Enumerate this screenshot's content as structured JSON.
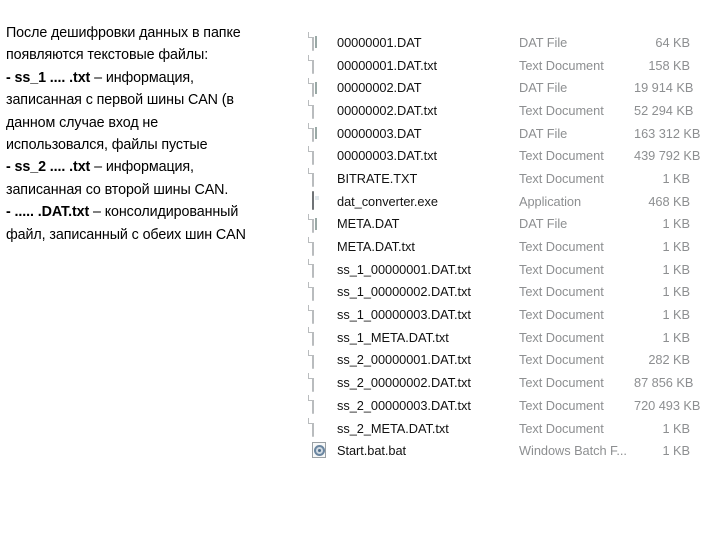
{
  "notes": {
    "lines": [
      {
        "text": "После дешифровки данных в папке",
        "bold_prefix": ""
      },
      {
        "text": "появляются текстовые файлы:",
        "bold_prefix": ""
      },
      {
        "text": " – информация,",
        "bold_prefix": "- ss_1 .... .txt"
      },
      {
        "text": "записанная с первой шины CAN (в",
        "bold_prefix": ""
      },
      {
        "text": "данном случае вход не",
        "bold_prefix": ""
      },
      {
        "text": "использовался, файлы пустые",
        "bold_prefix": ""
      },
      {
        "text": " – информация,",
        "bold_prefix": "- ss_2 .... .txt"
      },
      {
        "text": "записанная со второй шины CAN.",
        "bold_prefix": ""
      },
      {
        "text": " – консолидированный",
        "bold_prefix": "- ..... .DAT.txt"
      },
      {
        "text": "файл, записанный с обеих шин CAN",
        "bold_prefix": ""
      }
    ]
  },
  "file_list": {
    "rows": [
      {
        "icon": "dat-file-icon",
        "name": "00000001.DAT",
        "type": "DAT File",
        "size": "64 KB"
      },
      {
        "icon": "text-document-icon",
        "name": "00000001.DAT.txt",
        "type": "Text Document",
        "size": "158 KB"
      },
      {
        "icon": "dat-file-icon",
        "name": "00000002.DAT",
        "type": "DAT File",
        "size": "19 914 KB"
      },
      {
        "icon": "text-document-icon",
        "name": "00000002.DAT.txt",
        "type": "Text Document",
        "size": "52 294 KB"
      },
      {
        "icon": "dat-file-icon",
        "name": "00000003.DAT",
        "type": "DAT File",
        "size": "163 312 KB"
      },
      {
        "icon": "text-document-icon",
        "name": "00000003.DAT.txt",
        "type": "Text Document",
        "size": "439 792 KB"
      },
      {
        "icon": "text-document-icon",
        "name": "BITRATE.TXT",
        "type": "Text Document",
        "size": "1 KB"
      },
      {
        "icon": "application-exe-icon",
        "name": "dat_converter.exe",
        "type": "Application",
        "size": "468 KB"
      },
      {
        "icon": "dat-file-icon",
        "name": "META.DAT",
        "type": "DAT File",
        "size": "1 KB"
      },
      {
        "icon": "text-document-icon",
        "name": "META.DAT.txt",
        "type": "Text Document",
        "size": "1 KB"
      },
      {
        "icon": "text-document-icon",
        "name": "ss_1_00000001.DAT.txt",
        "type": "Text Document",
        "size": "1 KB"
      },
      {
        "icon": "text-document-icon",
        "name": "ss_1_00000002.DAT.txt",
        "type": "Text Document",
        "size": "1 KB"
      },
      {
        "icon": "text-document-icon",
        "name": "ss_1_00000003.DAT.txt",
        "type": "Text Document",
        "size": "1 KB"
      },
      {
        "icon": "text-document-icon",
        "name": "ss_1_META.DAT.txt",
        "type": "Text Document",
        "size": "1 KB"
      },
      {
        "icon": "text-document-icon",
        "name": "ss_2_00000001.DAT.txt",
        "type": "Text Document",
        "size": "282 KB"
      },
      {
        "icon": "text-document-icon",
        "name": "ss_2_00000002.DAT.txt",
        "type": "Text Document",
        "size": "87 856 KB"
      },
      {
        "icon": "text-document-icon",
        "name": "ss_2_00000003.DAT.txt",
        "type": "Text Document",
        "size": "720 493 KB"
      },
      {
        "icon": "text-document-icon",
        "name": "ss_2_META.DAT.txt",
        "type": "Text Document",
        "size": "1 KB"
      },
      {
        "icon": "batch-file-icon",
        "name": "Start.bat.bat",
        "type": "Windows Batch F...",
        "size": "1 KB"
      }
    ]
  },
  "colors": {
    "background": "#ffffff",
    "name_text": "#121212",
    "meta_text": "#8d8f91"
  }
}
